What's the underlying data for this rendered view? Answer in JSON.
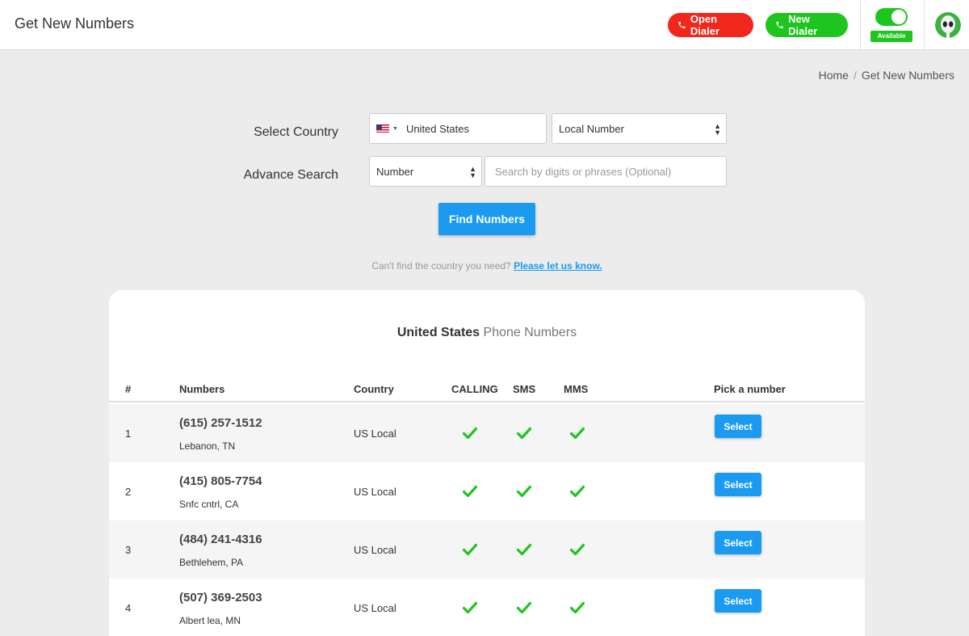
{
  "header": {
    "title": "Get New Numbers",
    "open_dialer": "Open Dialer",
    "new_dialer": "New Dialer",
    "status": "Available"
  },
  "breadcrumb": {
    "home": "Home",
    "separator": "/",
    "current": "Get New Numbers"
  },
  "form": {
    "country_label": "Select Country",
    "country_value": "United States",
    "number_type_value": "Local Number",
    "advance_label": "Advance Search",
    "search_type_value": "Number",
    "search_placeholder": "Search by digits or phrases (Optional)",
    "find_button": "Find Numbers",
    "hint_text": "Can't find the country you need?",
    "hint_link": "Please let us know."
  },
  "results": {
    "title_strong": "United States",
    "title_light": "Phone Numbers",
    "columns": [
      "#",
      "Numbers",
      "Country",
      "CALLING",
      "SMS",
      "MMS",
      "Pick a number"
    ],
    "select_label": "Select",
    "rows": [
      {
        "index": "1",
        "number": "(615) 257-1512",
        "location": "Lebanon, TN",
        "country": "US Local"
      },
      {
        "index": "2",
        "number": "(415) 805-7754",
        "location": "Snfc cntrl, CA",
        "country": "US Local"
      },
      {
        "index": "3",
        "number": "(484) 241-4316",
        "location": "Bethlehem, PA",
        "country": "US Local"
      },
      {
        "index": "4",
        "number": "(507) 369-2503",
        "location": "Albert lea, MN",
        "country": "US Local"
      }
    ]
  },
  "colors": {
    "accent_blue": "#1a9bf0",
    "danger_red": "#f2271c",
    "success_green": "#1fc51f"
  }
}
